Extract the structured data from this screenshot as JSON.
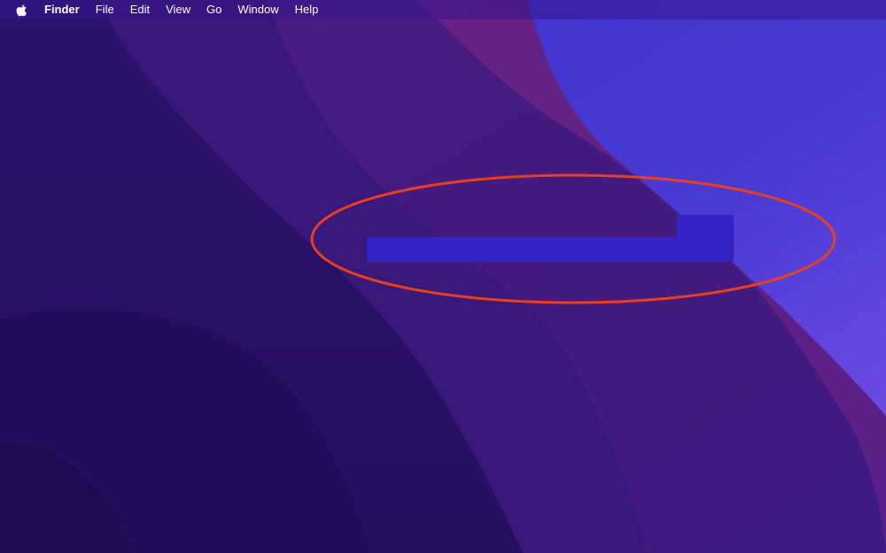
{
  "menubar": {
    "apple_menu_icon": "apple-icon",
    "app_name": "Finder",
    "items": [
      "File",
      "Edit",
      "View",
      "Go",
      "Window",
      "Help"
    ]
  },
  "colors": {
    "annotation_stroke": "#e8401c",
    "highlight_fill": "#3322c4"
  }
}
